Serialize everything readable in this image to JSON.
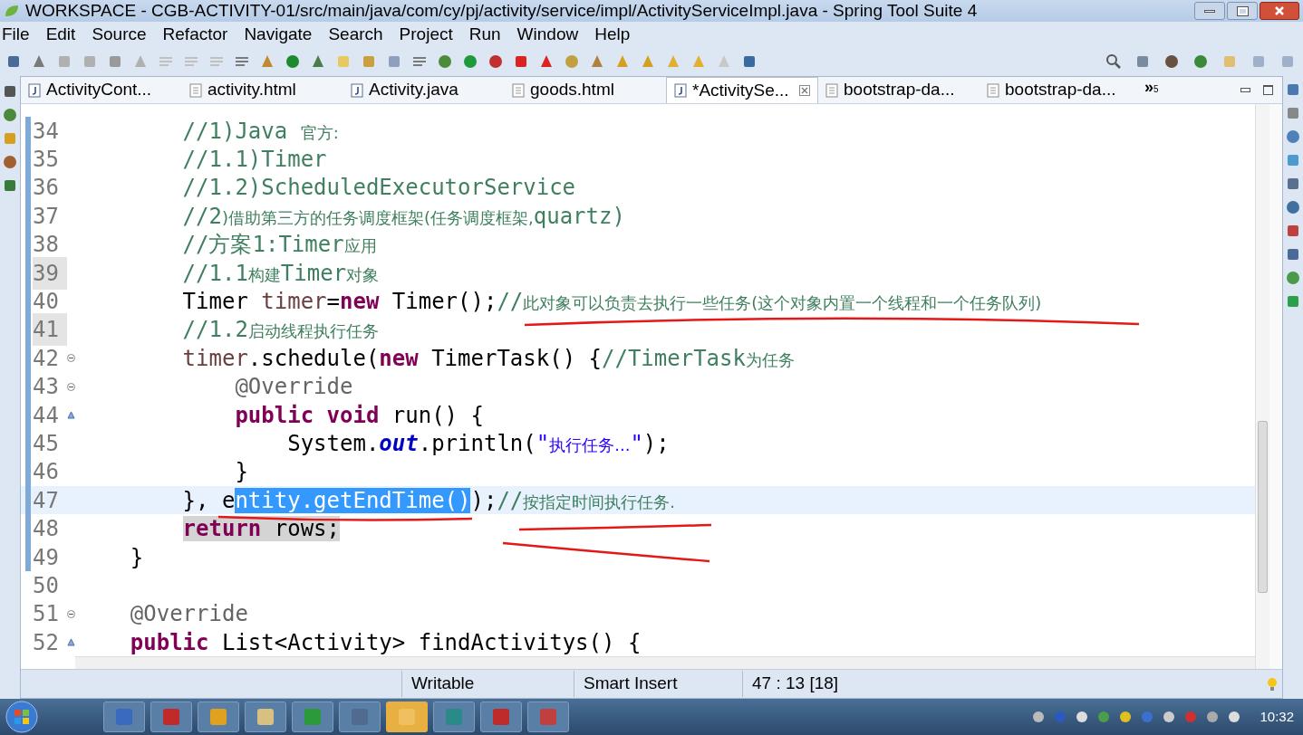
{
  "window": {
    "title": "WORKSPACE - CGB-ACTIVITY-01/src/main/java/com/cy/pj/activity/service/impl/ActivityServiceImpl.java - Spring Tool Suite 4"
  },
  "menu": [
    "File",
    "Edit",
    "Source",
    "Refactor",
    "Navigate",
    "Search",
    "Project",
    "Run",
    "Window",
    "Help"
  ],
  "tabs": [
    {
      "label": "ActivityCont...",
      "kind": "java",
      "selected": false
    },
    {
      "label": "activity.html",
      "kind": "html",
      "selected": false
    },
    {
      "label": "Activity.java",
      "kind": "java",
      "selected": false
    },
    {
      "label": "goods.html",
      "kind": "html",
      "selected": false
    },
    {
      "label": "*ActivitySe...",
      "kind": "java",
      "selected": true
    },
    {
      "label": "bootstrap-da...",
      "kind": "html",
      "selected": false
    },
    {
      "label": "bootstrap-da...",
      "kind": "html",
      "selected": false
    }
  ],
  "tab_overflow": {
    "symbol": "»",
    "count": "5"
  },
  "code_lines": [
    {
      "number": "34",
      "fold": false,
      "override": false,
      "current": false,
      "shaded": false,
      "tokens": [
        {
          "kind": "comment",
          "text": "        //1)Java "
        },
        {
          "kind": "cjk",
          "text": "官方:"
        }
      ]
    },
    {
      "number": "35",
      "fold": false,
      "override": false,
      "current": false,
      "shaded": false,
      "tokens": [
        {
          "kind": "comment",
          "text": "        //1.1)Timer"
        }
      ]
    },
    {
      "number": "36",
      "fold": false,
      "override": false,
      "current": false,
      "shaded": false,
      "tokens": [
        {
          "kind": "comment",
          "text": "        //1.2)ScheduledExecutorService"
        }
      ]
    },
    {
      "number": "37",
      "fold": false,
      "override": false,
      "current": false,
      "shaded": false,
      "tokens": [
        {
          "kind": "comment",
          "text": "        //2"
        },
        {
          "kind": "cjk",
          "text": ")借助第三方的任务调度框架(任务调度框架,"
        },
        {
          "kind": "comment",
          "text": "quartz)"
        }
      ]
    },
    {
      "number": "38",
      "fold": false,
      "override": false,
      "current": false,
      "shaded": false,
      "tokens": [
        {
          "kind": "comment",
          "text": "        //方案1:Timer"
        },
        {
          "kind": "cjk",
          "text": "应用"
        }
      ]
    },
    {
      "number": "39",
      "fold": false,
      "override": false,
      "current": false,
      "shaded": true,
      "tokens": [
        {
          "kind": "comment",
          "text": "        //1.1"
        },
        {
          "kind": "cjk",
          "text": "构建"
        },
        {
          "kind": "comment",
          "text": "Timer"
        },
        {
          "kind": "cjk",
          "text": "对象"
        }
      ]
    },
    {
      "number": "40",
      "fold": false,
      "override": false,
      "current": false,
      "shaded": false,
      "tokens": [
        {
          "kind": "plain",
          "text": "        Timer "
        },
        {
          "kind": "local",
          "text": "timer"
        },
        {
          "kind": "plain",
          "text": "="
        },
        {
          "kind": "keyword",
          "text": "new"
        },
        {
          "kind": "plain",
          "text": " Timer();"
        },
        {
          "kind": "comment",
          "text": "//"
        },
        {
          "kind": "cjk",
          "text": "此对象可以负责去执行一些任务(这个对象内置一个线程和一个任务队列)"
        }
      ]
    },
    {
      "number": "41",
      "fold": false,
      "override": false,
      "current": false,
      "shaded": true,
      "tokens": [
        {
          "kind": "comment",
          "text": "        //1.2"
        },
        {
          "kind": "cjk",
          "text": "启动线程执行任务"
        }
      ]
    },
    {
      "number": "42",
      "fold": true,
      "override": false,
      "current": false,
      "shaded": false,
      "tokens": [
        {
          "kind": "local",
          "text": "        timer"
        },
        {
          "kind": "plain",
          "text": ".schedule("
        },
        {
          "kind": "keyword",
          "text": "new"
        },
        {
          "kind": "plain",
          "text": " TimerTask() {"
        },
        {
          "kind": "comment",
          "text": "//TimerTask"
        },
        {
          "kind": "cjk",
          "text": "为任务"
        }
      ]
    },
    {
      "number": "43",
      "fold": true,
      "override": false,
      "current": false,
      "shaded": false,
      "tokens": [
        {
          "kind": "annotation",
          "text": "            @Override"
        }
      ]
    },
    {
      "number": "44",
      "fold": false,
      "override": true,
      "current": false,
      "shaded": false,
      "tokens": [
        {
          "kind": "keyword",
          "text": "            public void"
        },
        {
          "kind": "plain",
          "text": " run() {"
        }
      ]
    },
    {
      "number": "45",
      "fold": false,
      "override": false,
      "current": false,
      "shaded": false,
      "tokens": [
        {
          "kind": "plain",
          "text": "                System."
        },
        {
          "kind": "field",
          "text": "out"
        },
        {
          "kind": "plain",
          "text": ".println("
        },
        {
          "kind": "string",
          "text": "\""
        },
        {
          "kind": "string_cjk",
          "text": "执行任务..."
        },
        {
          "kind": "string",
          "text": "\""
        },
        {
          "kind": "plain",
          "text": ");"
        }
      ]
    },
    {
      "number": "46",
      "fold": false,
      "override": false,
      "current": false,
      "shaded": false,
      "tokens": [
        {
          "kind": "plain",
          "text": "            }"
        }
      ]
    },
    {
      "number": "47",
      "fold": false,
      "override": false,
      "current": true,
      "shaded": false,
      "tokens": [
        {
          "kind": "plain",
          "text": "        }, e"
        },
        {
          "kind": "selected",
          "text": "ntity.getEndTime()"
        },
        {
          "kind": "plain",
          "text": ");"
        },
        {
          "kind": "comment",
          "text": "//"
        },
        {
          "kind": "cjk",
          "text": "按指定时间执行任务."
        }
      ]
    },
    {
      "number": "48",
      "fold": false,
      "override": false,
      "current": false,
      "shaded": false,
      "tokens": [
        {
          "kind": "occurrence_keyword",
          "text": "        return"
        },
        {
          "kind": "occurrence",
          "text": " rows;"
        }
      ]
    },
    {
      "number": "49",
      "fold": false,
      "override": false,
      "current": false,
      "shaded": false,
      "tokens": [
        {
          "kind": "plain",
          "text": "    }"
        }
      ]
    },
    {
      "number": "50",
      "fold": false,
      "override": false,
      "current": false,
      "shaded": false
    },
    {
      "number": "51",
      "fold": true,
      "override": false,
      "current": false,
      "shaded": false,
      "tokens": [
        {
          "kind": "annotation",
          "text": "    @Override"
        }
      ]
    },
    {
      "number": "52",
      "fold": false,
      "override": true,
      "current": false,
      "shaded": false,
      "tokens": [
        {
          "kind": "keyword",
          "text": "    public"
        },
        {
          "kind": "plain",
          "text": " List<Activity> findActivitys() {"
        }
      ]
    }
  ],
  "status_bar": {
    "mode": "Writable",
    "insert": "Smart Insert",
    "position": "47 : 13 [18]"
  },
  "taskbar": {
    "time": "10:32"
  }
}
